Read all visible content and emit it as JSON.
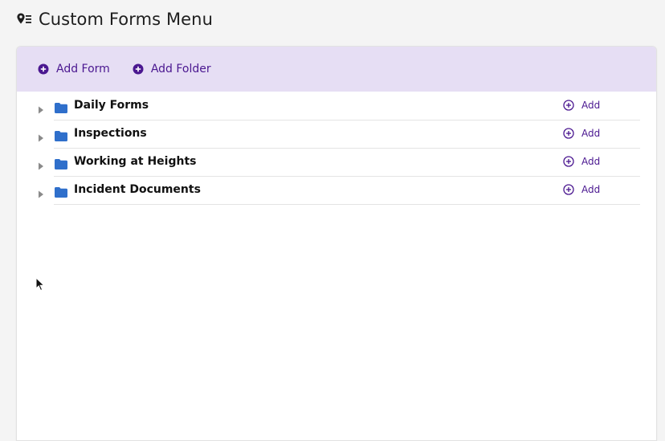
{
  "header": {
    "title": "Custom Forms Menu",
    "icon": "location-list-icon"
  },
  "toolbar": {
    "add_form_label": "Add Form",
    "add_folder_label": "Add Folder"
  },
  "folders": [
    {
      "name": "Daily Forms",
      "add_label": "Add"
    },
    {
      "name": "Inspections",
      "add_label": "Add"
    },
    {
      "name": "Working at Heights",
      "add_label": "Add"
    },
    {
      "name": "Incident Documents",
      "add_label": "Add"
    }
  ],
  "colors": {
    "accent": "#4a1790",
    "toolbar_bg": "#e6def4",
    "folder": "#2f6fcb"
  }
}
